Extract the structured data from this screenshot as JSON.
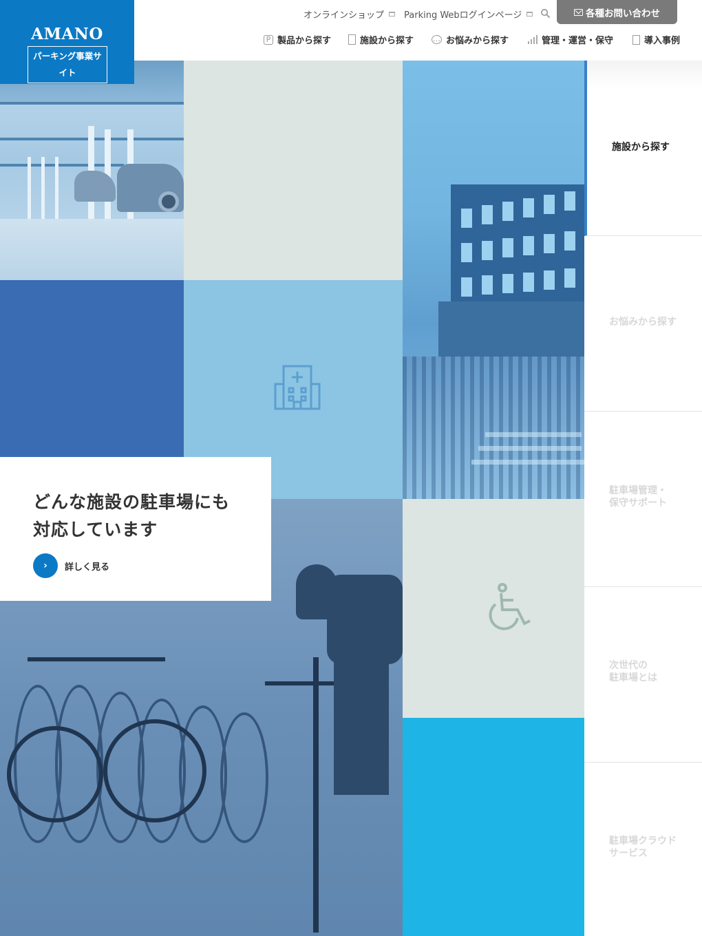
{
  "brand": {
    "logo": "AMANO",
    "subtitle": "パーキング事業サイト",
    "color": "#0c79c5"
  },
  "header": {
    "util_links": [
      {
        "label": "オンラインショップ",
        "icon": "external-link-icon"
      },
      {
        "label": "Parking Webログインページ",
        "icon": "external-link-icon"
      }
    ],
    "search_icon": "search-icon",
    "contact": {
      "label": "各種お問い合わせ",
      "icon": "mail-icon"
    }
  },
  "nav": [
    {
      "label": "製品から探す",
      "icon": "parking-icon"
    },
    {
      "label": "施設から探す",
      "icon": "building-icon"
    },
    {
      "label": "お悩みから探す",
      "icon": "speech-bubble-icon"
    },
    {
      "label": "管理・運営・保守",
      "icon": "bar-chart-icon"
    },
    {
      "label": "導入事例",
      "icon": "document-icon"
    }
  ],
  "feature": {
    "title_line1": "どんな施設の駐車場にも",
    "title_line2": "対応しています",
    "link_label": "詳しく見る",
    "link_icon": "chevron-right-icon"
  },
  "tiles": {
    "hospital_icon": "hospital-icon",
    "wheelchair_icon": "wheelchair-icon",
    "colors": {
      "pale": "#dce5e1",
      "dark_blue": "#3a6cb4",
      "light_blue": "#8cc4e3",
      "cyan": "#1eb4e6"
    }
  },
  "side_tabs": [
    {
      "line1": "施設から探す",
      "line2": "",
      "active": true
    },
    {
      "line1": "お悩みから探す",
      "line2": "",
      "active": false
    },
    {
      "line1": "駐車場管理・",
      "line2": "保守サポート",
      "active": false
    },
    {
      "line1": "次世代の",
      "line2": "駐車場とは",
      "active": false
    },
    {
      "line1": "駐車場クラウド",
      "line2": "サービス",
      "active": false
    }
  ]
}
